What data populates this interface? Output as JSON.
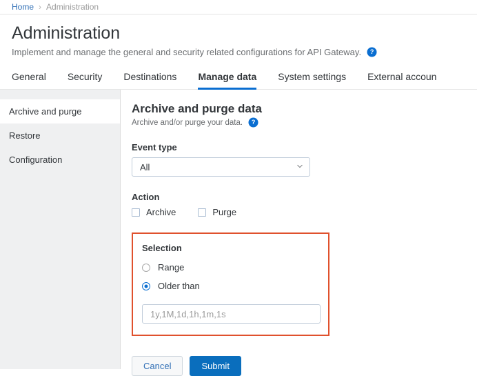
{
  "breadcrumb": {
    "home_label": "Home",
    "separator": "›",
    "current_label": "Administration"
  },
  "header": {
    "title": "Administration",
    "subtitle": "Implement and manage the general and security related configurations for API Gateway.",
    "help_icon": "help-circle-icon",
    "help_glyph": "?"
  },
  "tabs": [
    {
      "label": "General",
      "active": false
    },
    {
      "label": "Security",
      "active": false
    },
    {
      "label": "Destinations",
      "active": false
    },
    {
      "label": "Manage data",
      "active": true
    },
    {
      "label": "System settings",
      "active": false
    },
    {
      "label": "External accoun",
      "active": false
    }
  ],
  "sidebar": {
    "items": [
      {
        "label": "Archive and purge",
        "active": true
      },
      {
        "label": "Restore",
        "active": false
      },
      {
        "label": "Configuration",
        "active": false
      }
    ]
  },
  "main": {
    "section_title": "Archive and purge data",
    "section_subtitle": "Archive and/or purge your data.",
    "help_glyph": "?",
    "event_type": {
      "label": "Event type",
      "selected": "All",
      "chevron_icon": "chevron-down-icon"
    },
    "action": {
      "label": "Action",
      "options": [
        {
          "label": "Archive",
          "checked": false
        },
        {
          "label": "Purge",
          "checked": false
        }
      ]
    },
    "selection": {
      "label": "Selection",
      "options": [
        {
          "label": "Range",
          "checked": false
        },
        {
          "label": "Older than",
          "checked": true
        }
      ],
      "input_value": "",
      "input_placeholder": "1y,1M,1d,1h,1m,1s"
    },
    "buttons": {
      "cancel_label": "Cancel",
      "submit_label": "Submit"
    }
  },
  "colors": {
    "accent_blue": "#0a6ed1",
    "primary_button": "#0a6ebd",
    "link_blue": "#2f6eb5",
    "highlight_border_red": "#e0512d",
    "sidebar_bg": "#eff0f1",
    "text_primary": "#32363a",
    "text_secondary": "#6a6d70"
  }
}
